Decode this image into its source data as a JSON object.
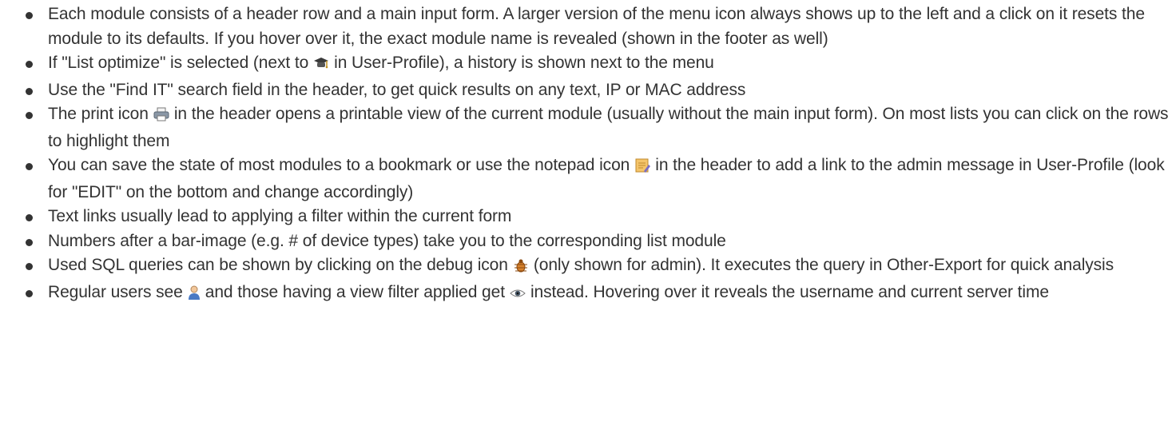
{
  "tips": [
    {
      "text": "Each module consists of a header row and a main input form. A larger version of the menu icon always shows up to the left and a click on it resets the module to its defaults. If you hover over it, the exact module name is revealed (shown in the footer as well)"
    },
    {
      "before": "If \"List optimize\" is selected (next to",
      "icon": "mortarboard-icon",
      "after": "in User-Profile), a history is shown next to the menu"
    },
    {
      "text": "Use the \"Find IT\" search field in the header, to get quick results on any text, IP or MAC address"
    },
    {
      "before": "The print icon",
      "icon": "printer-icon",
      "after": "in the header opens a printable view of the current module (usually without the main input form). On most lists you can click on the rows to highlight them"
    },
    {
      "before": "You can save the state of most modules to a bookmark or use the notepad icon",
      "icon": "notepad-icon",
      "after": "in the header to add a link to the admin message in User-Profile (look for \"EDIT\" on the bottom and change accordingly)"
    },
    {
      "text": "Text links usually lead to applying a filter within the current form"
    },
    {
      "text": "Numbers after a bar-image (e.g. # of device types) take you to the corresponding list module"
    },
    {
      "before": "Used SQL queries can be shown by clicking on the debug icon",
      "icon": "bug-icon",
      "after": "(only shown for admin). It executes the query in Other-Export for quick analysis"
    },
    {
      "before": "Regular users see",
      "icon": "user-icon",
      "middle": "and those having a view filter applied get",
      "icon2": "eye-icon",
      "after": "instead. Hovering over it reveals the username and current server time"
    }
  ]
}
